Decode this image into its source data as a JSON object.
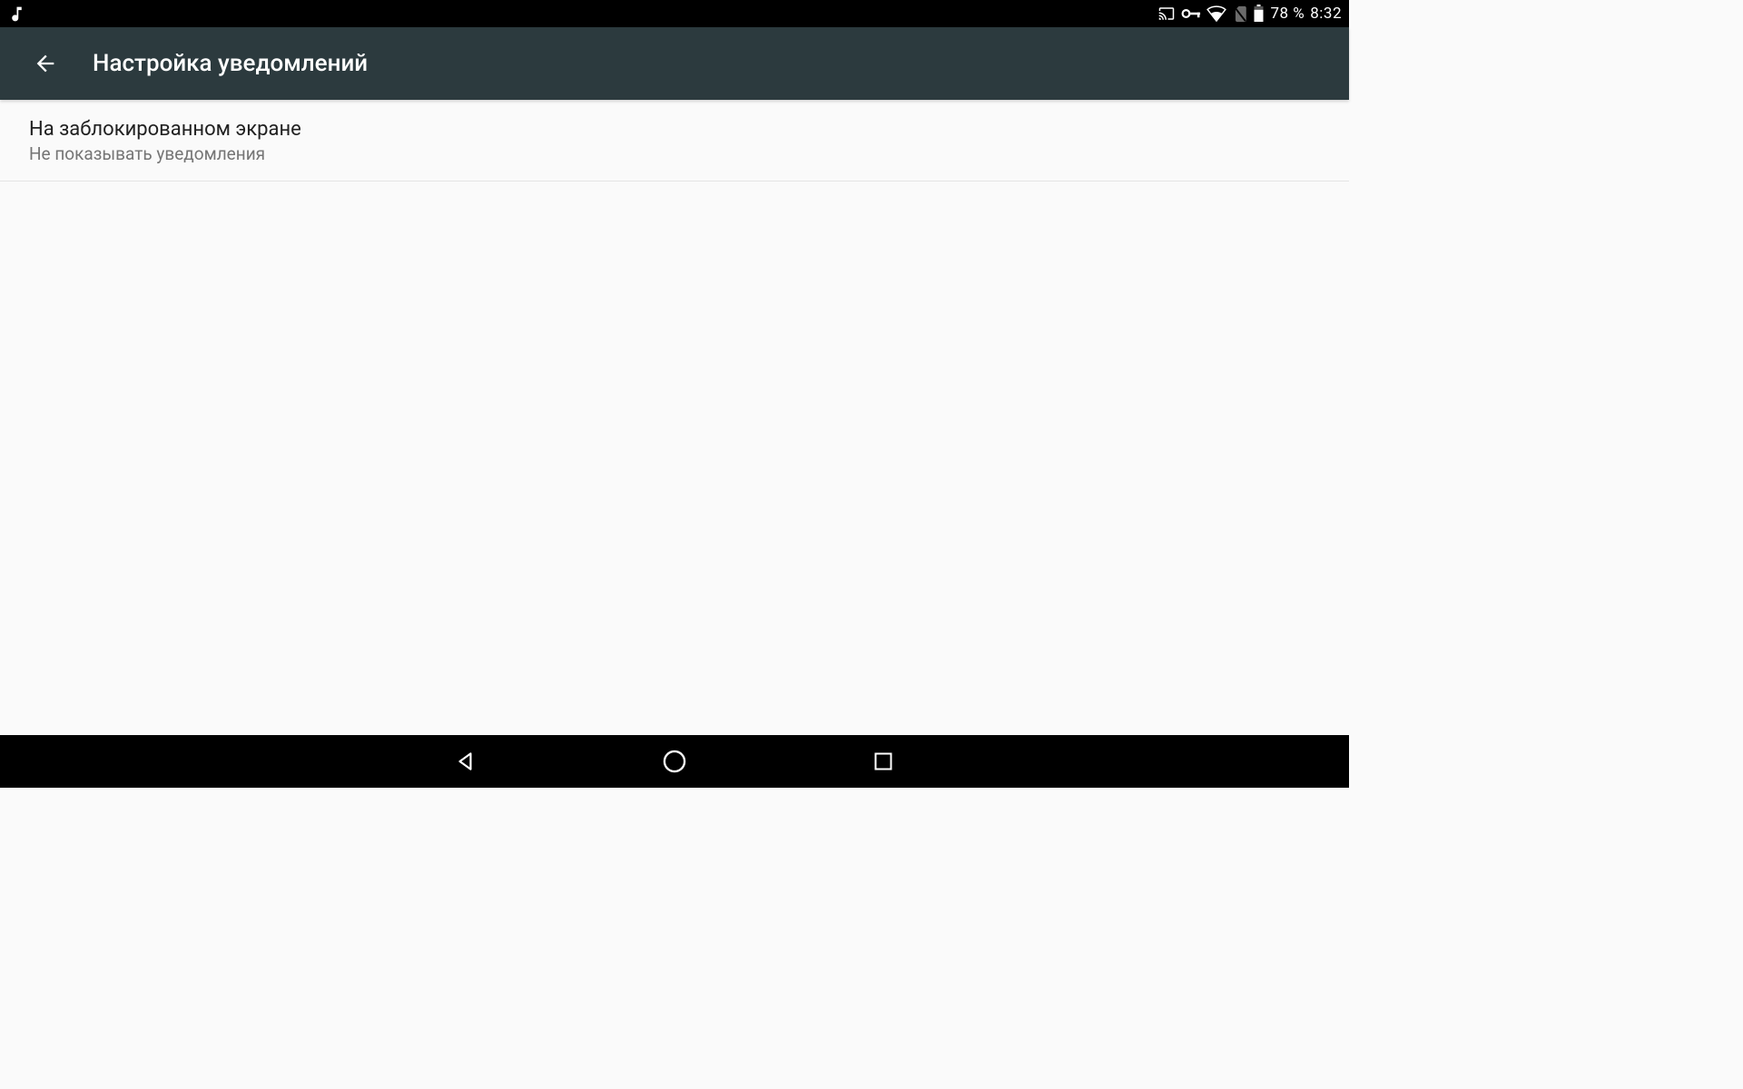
{
  "status_bar": {
    "battery_percent": "78 %",
    "time": "8:32"
  },
  "app_bar": {
    "title": "Настройка уведомлений"
  },
  "settings": {
    "lock_screen": {
      "title": "На заблокированном экране",
      "subtitle": "Не показывать уведомления"
    }
  }
}
